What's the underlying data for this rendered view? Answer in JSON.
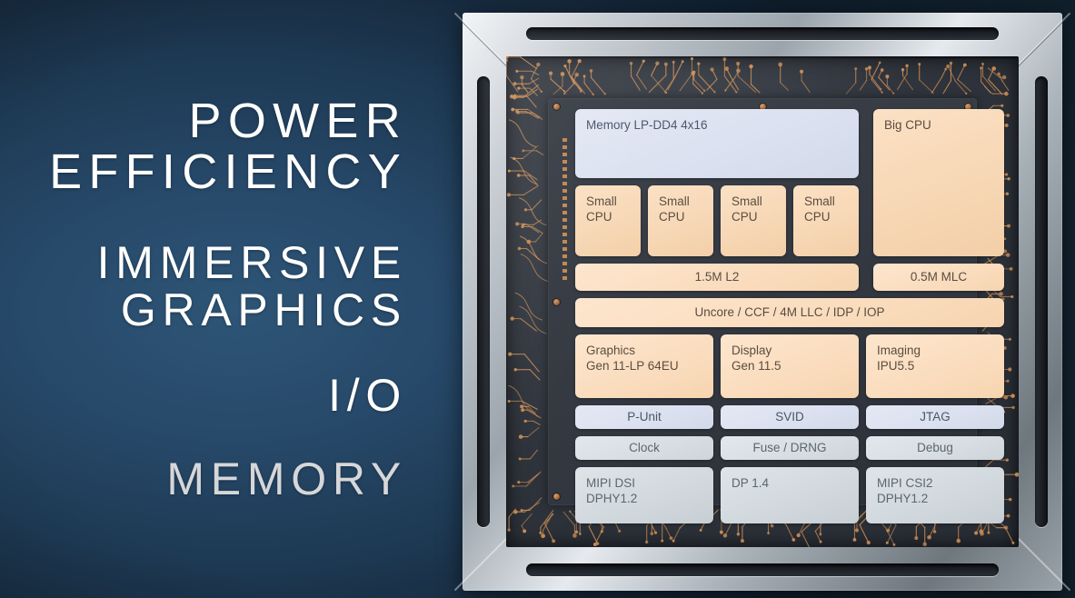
{
  "background": {
    "accent_navy": "#27496a",
    "edge_navy": "#102030"
  },
  "headings": {
    "groups": [
      {
        "lines": [
          "POWER",
          "EFFICIENCY"
        ]
      },
      {
        "lines": [
          "IMMERSIVE",
          "GRAPHICS"
        ]
      },
      {
        "lines": [
          "I/O"
        ]
      },
      {
        "lines": [
          "MEMORY"
        ]
      }
    ],
    "color": "#ffffff",
    "memory_color": "#d6d7d9"
  },
  "chip": {
    "frame_color": "#c9ced4",
    "substrate_color": "#2e333b",
    "trace_color": "#c98b54",
    "blocks": {
      "memory": "Memory LP-DD4 4x16",
      "big_cpu": "Big CPU",
      "small_cpu_1": "Small\nCPU",
      "small_cpu_2": "Small\nCPU",
      "small_cpu_3": "Small\nCPU",
      "small_cpu_4": "Small\nCPU",
      "l2": "1.5M L2",
      "mlc": "0.5M MLC",
      "uncore": "Uncore / CCF / 4M LLC / IDP / IOP",
      "graphics": "Graphics\nGen 11-LP 64EU",
      "display": "Display\nGen 11.5",
      "imaging": "Imaging\nIPU5.5",
      "punit": "P-Unit",
      "svid": "SVID",
      "jtag": "JTAG",
      "clock": "Clock",
      "fuse": "Fuse / DRNG",
      "debug": "Debug",
      "mipi_dsi": "MIPI DSI\nDPHY1.2",
      "dp": "DP 1.4",
      "mipi_csi2": "MIPI CSI2\nDPHY1.2"
    }
  }
}
